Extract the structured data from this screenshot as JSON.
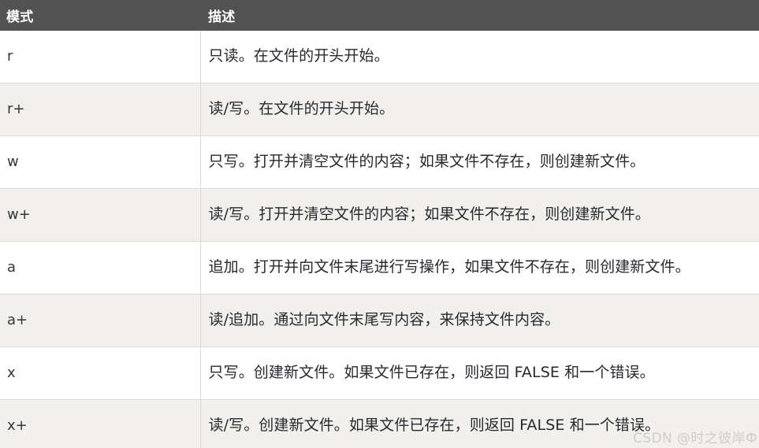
{
  "table": {
    "headers": {
      "mode": "模式",
      "description": "描述"
    },
    "rows": [
      {
        "mode": "r",
        "description": "只读。在文件的开头开始。"
      },
      {
        "mode": "r+",
        "description": "读/写。在文件的开头开始。"
      },
      {
        "mode": "w",
        "description": "只写。打开并清空文件的内容；如果文件不存在，则创建新文件。"
      },
      {
        "mode": "w+",
        "description": "读/写。打开并清空文件的内容；如果文件不存在，则创建新文件。"
      },
      {
        "mode": "a",
        "description": "追加。打开并向文件末尾进行写操作，如果文件不存在，则创建新文件。"
      },
      {
        "mode": "a+",
        "description": "读/追加。通过向文件末尾写内容，来保持文件内容。"
      },
      {
        "mode": "x",
        "description": "只写。创建新文件。如果文件已存在，则返回 FALSE 和一个错误。"
      },
      {
        "mode": "x+",
        "description": "读/写。创建新文件。如果文件已存在，则返回 FALSE 和一个错误。"
      }
    ]
  },
  "watermark": {
    "text": "CSDN @时之彼岸Ф"
  },
  "colors": {
    "header_background": "#525252",
    "header_text": "#ffffff",
    "row_odd_background": "#ffffff",
    "row_even_background": "#f2f0ed",
    "border": "#dddad6",
    "body_text": "#26292e",
    "watermark_text": "#cfcdca"
  }
}
